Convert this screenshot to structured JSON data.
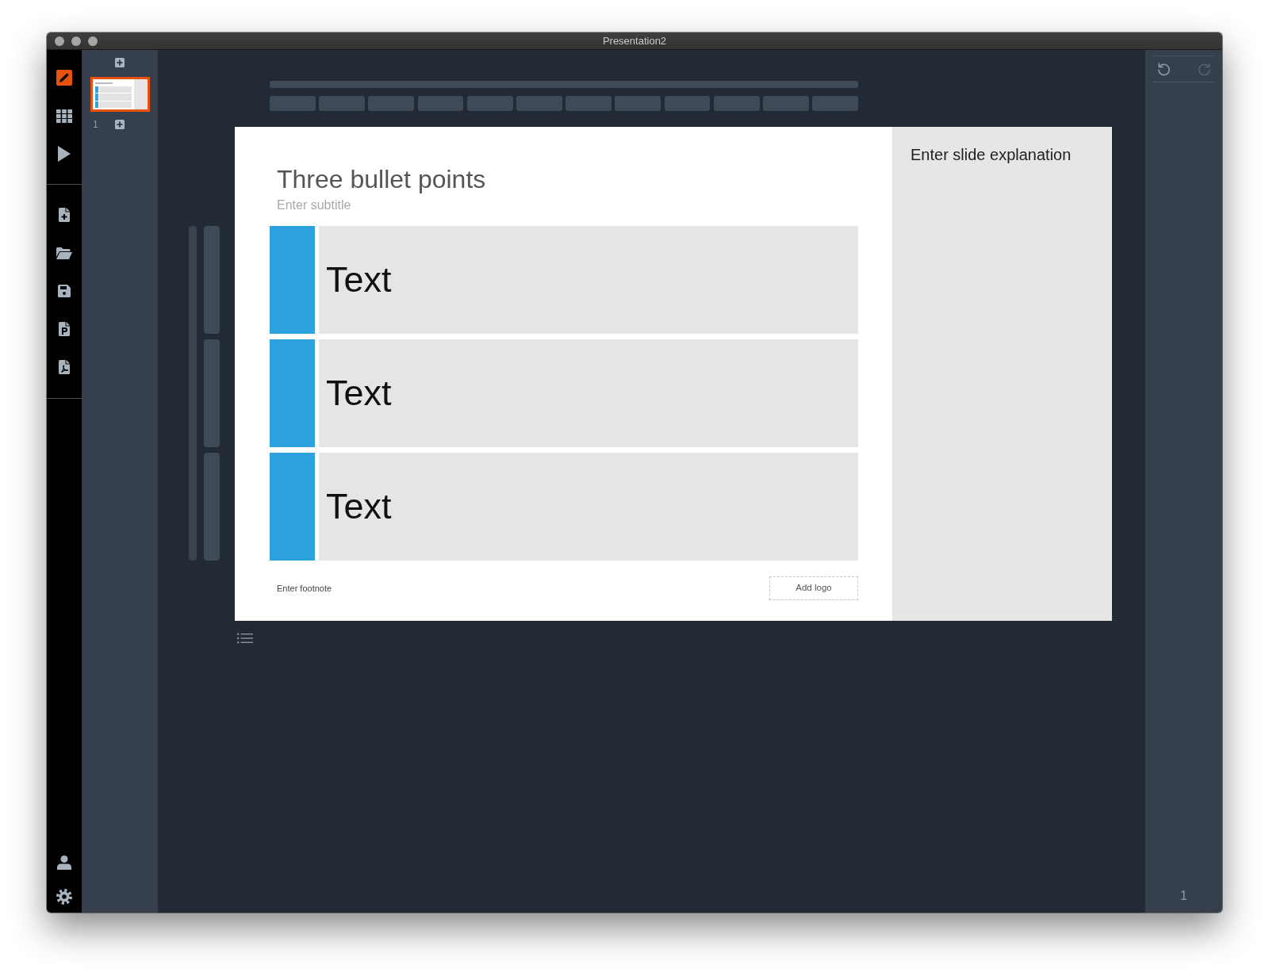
{
  "window": {
    "title": "Presentation2"
  },
  "nav": [
    {
      "kind": "edit",
      "selected": true
    },
    {
      "kind": "grid",
      "selected": false
    },
    {
      "kind": "play",
      "selected": false
    }
  ],
  "slides": [
    {
      "number": "1",
      "selected": true
    }
  ],
  "slide": {
    "title": "Three bullet points",
    "subtitle": "Enter subtitle",
    "bullets": [
      "Text",
      "Text",
      "Text"
    ],
    "footnote": "Enter footnote",
    "logo_button": "Add logo",
    "explanation": "Enter slide explanation"
  },
  "history": [
    {
      "kind": "undo",
      "disabled": false
    },
    {
      "kind": "redo",
      "disabled": true
    }
  ],
  "page_number": "1"
}
